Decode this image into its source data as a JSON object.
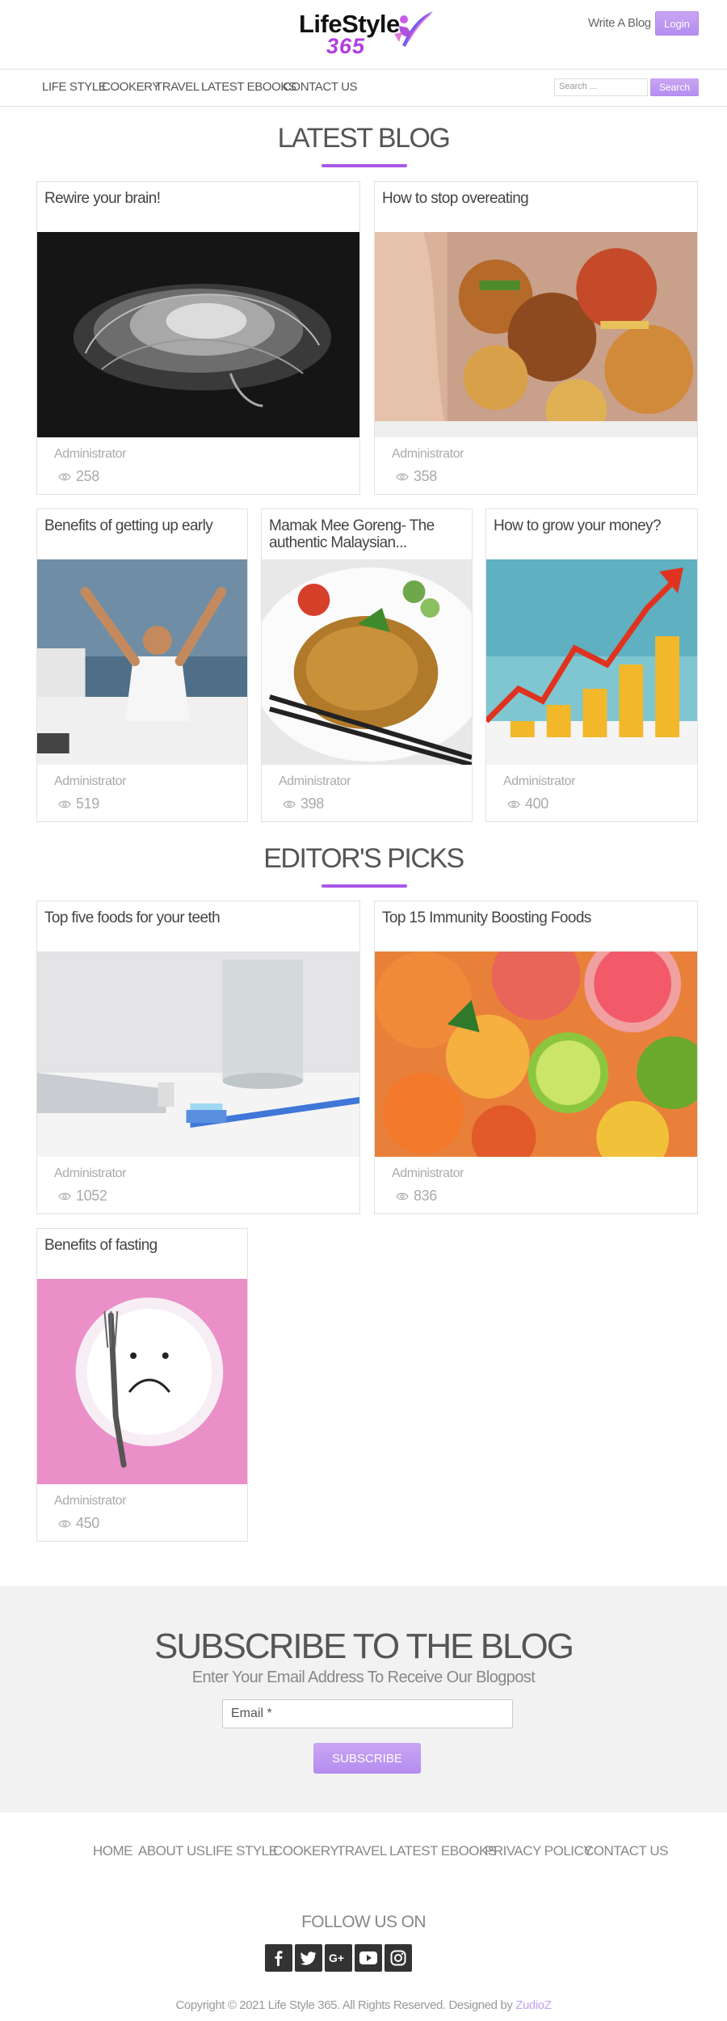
{
  "header": {
    "logo_line1": "LifeStyle",
    "logo_line2": "365",
    "write_blog": "Write A Blog",
    "login": "Login"
  },
  "nav": {
    "items": [
      "LIFE STYLE",
      "COOKERY",
      "TRAVEL",
      "LATEST EBOOKS",
      "CONTACT US"
    ],
    "search_placeholder": "Search ...",
    "search_button": "Search"
  },
  "latest_blog": {
    "title": "LATEST BLOG",
    "posts": [
      {
        "title": "Rewire your brain!",
        "author": "Administrator",
        "views": "258",
        "image": "brain-image"
      },
      {
        "title": "How to stop overeating",
        "author": "Administrator",
        "views": "358",
        "image": "junk-food-image"
      },
      {
        "title": "Benefits of getting up early",
        "author": "Administrator",
        "views": "519",
        "image": "waking-man-image"
      },
      {
        "title": "Mamak Mee Goreng- The authentic Malaysian...",
        "author": "Administrator",
        "views": "398",
        "image": "noodles-image"
      },
      {
        "title": "How to grow your money?",
        "author": "Administrator",
        "views": "400",
        "image": "coins-growth-image"
      }
    ]
  },
  "editors_picks": {
    "title": "EDITOR'S PICKS",
    "posts": [
      {
        "title": "Top five foods for your teeth",
        "author": "Administrator",
        "views": "1052",
        "image": "toothbrush-image"
      },
      {
        "title": "Top 15 Immunity Boosting Foods",
        "author": "Administrator",
        "views": "836",
        "image": "citrus-image"
      },
      {
        "title": "Benefits of fasting",
        "author": "Administrator",
        "views": "450",
        "image": "sad-plate-image"
      }
    ]
  },
  "subscribe": {
    "title": "SUBSCRIBE TO THE BLOG",
    "subtitle": "Enter Your Email Address To Receive Our Blogpost",
    "email_placeholder": "Email *",
    "button": "SUBSCRIBE"
  },
  "footer": {
    "links": [
      "HOME",
      "ABOUT US",
      "LIFE STYLE",
      "COOKERY",
      "TRAVEL",
      "LATEST EBOOKS",
      "PRIVACY POLICY",
      "CONTACT US"
    ],
    "follow": "FOLLOW US ON",
    "social": [
      "facebook-icon",
      "twitter-icon",
      "google-plus-icon",
      "youtube-icon",
      "instagram-icon"
    ],
    "copyright": "Copyright © 2021 Life Style 365. All Rights Reserved. Designed by",
    "designer": "ZudioZ"
  },
  "colors": {
    "accent": "#a957e8",
    "button": "#bb95f1",
    "subscribe_bg": "#f2f2f2"
  }
}
